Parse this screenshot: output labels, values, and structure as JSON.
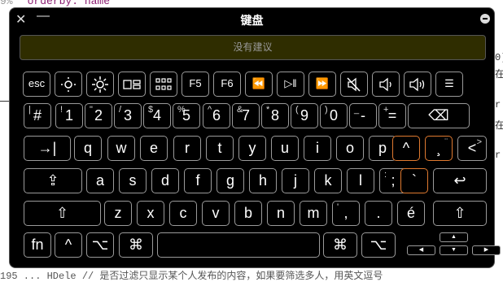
{
  "background": {
    "top_line_number": "9%",
    "top_code": "orderby: name",
    "bottom_code": "195    ...        HDele  // 是否过滤只显示某个人发布的内容，如果要筛选多人，用英文逗号",
    "side_fragments": [
      "0)",
      "在",
      "r",
      "在",
      "r"
    ]
  },
  "window": {
    "title": "键盘",
    "close_label": "✕",
    "minimize_label": "—"
  },
  "suggestion_bar": {
    "text": "没有建议"
  },
  "rows": {
    "function": [
      {
        "name": "key-esc",
        "label": "esc"
      },
      {
        "name": "key-brightness-down",
        "icon": "brightness-low-icon"
      },
      {
        "name": "key-brightness-up",
        "icon": "brightness-high-icon"
      },
      {
        "name": "key-mission-control",
        "icon": "mission-control-icon"
      },
      {
        "name": "key-launchpad",
        "icon": "launchpad-icon"
      },
      {
        "name": "key-f5",
        "label": "F5"
      },
      {
        "name": "key-f6",
        "label": "F6"
      },
      {
        "name": "key-rewind",
        "label": "⏪"
      },
      {
        "name": "key-play-pause",
        "label": "▷‖"
      },
      {
        "name": "key-fast-forward",
        "label": "⏩"
      },
      {
        "name": "key-mute",
        "icon": "mute-icon"
      },
      {
        "name": "key-volume-down",
        "icon": "volume-down-icon"
      },
      {
        "name": "key-volume-up",
        "icon": "volume-up-icon"
      },
      {
        "name": "key-menu",
        "label": "☰"
      }
    ],
    "number": [
      {
        "main": "#",
        "sec": "|"
      },
      {
        "main": "1",
        "sec": "!"
      },
      {
        "main": "2",
        "sec": "\""
      },
      {
        "main": "3",
        "sec": "/"
      },
      {
        "main": "4",
        "sec": "$"
      },
      {
        "main": "5",
        "sec": "%"
      },
      {
        "main": "6",
        "sec": "^"
      },
      {
        "main": "7",
        "sec": "&"
      },
      {
        "main": "8",
        "sec": "*"
      },
      {
        "main": "9",
        "sec": "("
      },
      {
        "main": "0",
        "sec": ")"
      },
      {
        "main": "-",
        "sec": "_"
      },
      {
        "main": "=",
        "sec": "+"
      },
      {
        "main": "⌫",
        "sec": ""
      }
    ],
    "top_letters": [
      "→|",
      "q",
      "w",
      "e",
      "r",
      "t",
      "y",
      "u",
      "i",
      "o",
      "p",
      "^",
      "¸",
      "<"
    ],
    "top_letters_sec": {
      "12": "¨",
      "13": ">"
    },
    "home_letters": [
      "⇪",
      "a",
      "s",
      "d",
      "f",
      "g",
      "h",
      "j",
      "k",
      "l",
      ";",
      "`",
      "↩"
    ],
    "home_letters_sec": {
      "10": ":"
    },
    "bottom_letters": [
      "⇧",
      "z",
      "x",
      "c",
      "v",
      "b",
      "n",
      "m",
      ",",
      ".",
      "é",
      "⇧"
    ],
    "bottom_letters_sec": {
      "8": "'"
    },
    "modifiers": [
      "fn",
      "^",
      "⌥",
      "⌘",
      "",
      "⌘",
      "⌥"
    ],
    "arrows": [
      "▲",
      "◀",
      "▼",
      "▶"
    ]
  },
  "colors": {
    "accent_highlight": "#e07a30",
    "suggestion_bg": "#2f2d00",
    "key_border": "#9a9a9a"
  }
}
